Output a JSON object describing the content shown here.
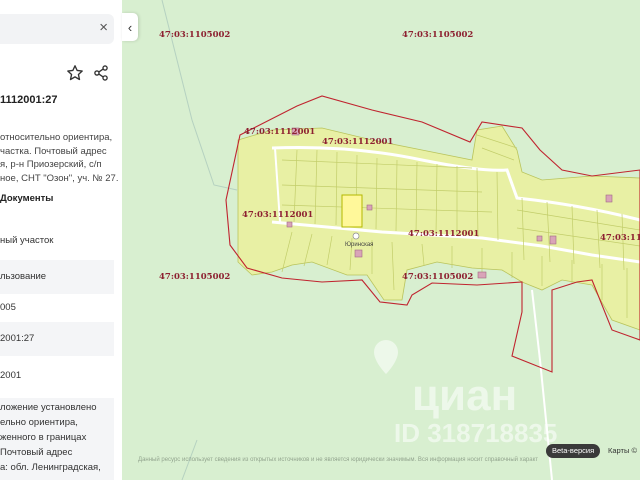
{
  "panel": {
    "close_glyph": "×",
    "cadastral_number": "1112001:27",
    "address_lines": [
      "относительно ориентира,",
      "частка. Почтовый адрес",
      "я, р-н Приозерский, с/п",
      "ное, СНТ \"Озон\", уч. № 27."
    ],
    "documents_label": "Документы",
    "rows": [
      {
        "text": "ный участок",
        "grey": false
      },
      {
        "text": "льзование",
        "grey": true
      },
      {
        "text": "005",
        "grey": false
      },
      {
        "text": "2001:27",
        "grey": true
      },
      {
        "text": "2001",
        "grey": false
      }
    ],
    "note_lines": [
      "ложение установлено",
      "ельно ориентира,",
      "женного в границах",
      "Почтовый адрес",
      "а: обл. Ленинградская,"
    ],
    "icons": {
      "favorite": "star-icon",
      "share": "share-icon",
      "close": "close-icon",
      "collapse": "chevron-left-icon"
    }
  },
  "map": {
    "collapse_glyph": "‹",
    "labels": [
      {
        "id": "lbl1",
        "text": "47:03:1105002"
      },
      {
        "id": "lbl2",
        "text": "47:03:1105002"
      },
      {
        "id": "lbl3",
        "text": "47:03:1112001"
      },
      {
        "id": "lbl4",
        "text": "47:03:1112001"
      },
      {
        "id": "lbl5",
        "text": "47:03:1112001"
      },
      {
        "id": "lbl6",
        "text": "47:03:1112001"
      },
      {
        "id": "lbl7",
        "text": "47:03:111"
      },
      {
        "id": "lbl8",
        "text": "47:03:1105002"
      },
      {
        "id": "lbl9",
        "text": "47:03:1105002"
      }
    ],
    "poi_label": "Юринская",
    "watermark_logo": "циан",
    "watermark_id": "ID 318718835",
    "bottom_note": "Данный ресурс использует сведения из открытых источников и не является юридически значимым. Вся информация носит справочный характер.",
    "beta_badge": "Beta-версия",
    "maps_attribution": "Карты ©"
  },
  "colors": {
    "plot_fill": "#e8f0a4",
    "plot_border": "#b9c45c",
    "boundary": "#c0242f",
    "label": "#8d2131",
    "background": "#d8efd0"
  }
}
